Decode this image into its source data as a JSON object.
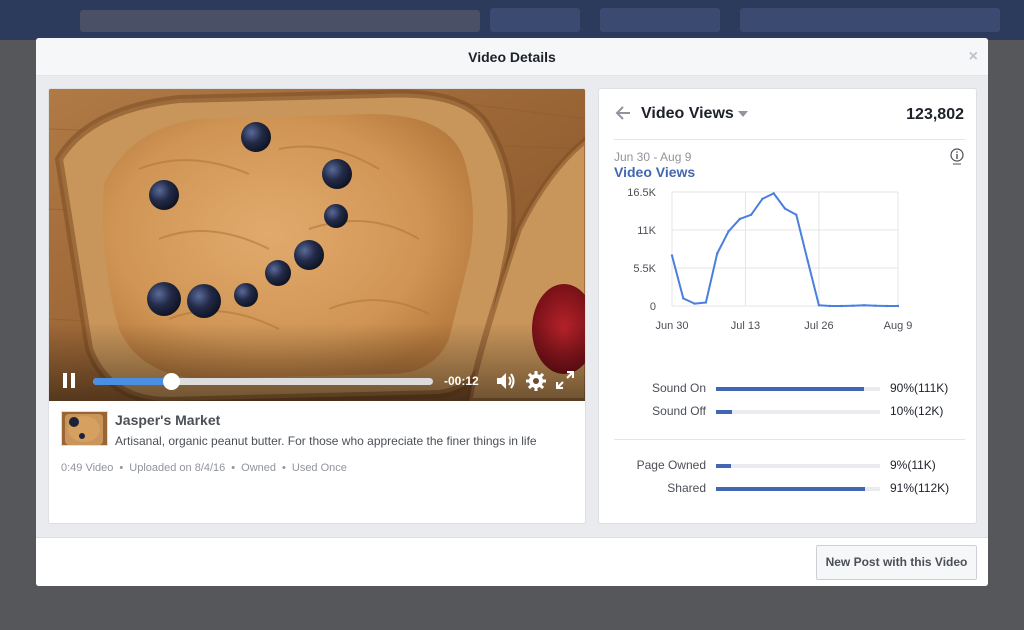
{
  "modal": {
    "title": "Video Details",
    "close_glyph": "×",
    "footer_button": "New Post with this Video"
  },
  "video": {
    "time_remaining": "-00:12",
    "progress": 0.23,
    "page_name": "Jasper's Market",
    "description": "Artisanal, organic peanut butter. For those who appreciate the finer things in life",
    "meta": [
      "0:49 Video",
      "Uploaded on 8/4/16",
      "Owned",
      "Used Once"
    ]
  },
  "insights": {
    "metric_title": "Video Views",
    "total": "123,802",
    "date_range": "Jun 30 - Aug 9",
    "chart_label": "Video Views",
    "stats_audio": [
      {
        "label": "Sound On",
        "value": "90%(111K)",
        "fraction": 0.9
      },
      {
        "label": "Sound Off",
        "value": "10%(12K)",
        "fraction": 0.1
      }
    ],
    "stats_ownership": [
      {
        "label": "Page Owned",
        "value": "9%(11K)",
        "fraction": 0.09
      },
      {
        "label": "Shared",
        "value": "91%(112K)",
        "fraction": 0.91
      }
    ]
  },
  "colors": {
    "accent": "#4267b2",
    "line": "#4a7fe0",
    "scrub": "#4a90e2"
  },
  "chart_data": {
    "type": "line",
    "title": "Video Views",
    "x_tick_labels": [
      "Jun 30",
      "Jul 13",
      "Jul 26",
      "Aug 9"
    ],
    "y_tick_labels": [
      "0",
      "5.5K",
      "11K",
      "16.5K"
    ],
    "ylim": [
      0,
      16500
    ],
    "grid": true,
    "series": [
      {
        "name": "Video Views",
        "x": [
          "Jun 30",
          "Jul 2",
          "Jul 4",
          "Jul 6",
          "Jul 8",
          "Jul 10",
          "Jul 12",
          "Jul 14",
          "Jul 16",
          "Jul 18",
          "Jul 20",
          "Jul 22",
          "Jul 24",
          "Jul 26",
          "Jul 28",
          "Jul 30",
          "Aug 1",
          "Aug 3",
          "Aug 5",
          "Aug 7",
          "Aug 9"
        ],
        "values": [
          7300,
          1100,
          350,
          500,
          7600,
          10800,
          12600,
          13200,
          15500,
          16300,
          14100,
          13200,
          6600,
          100,
          0,
          0,
          50,
          100,
          50,
          0,
          0
        ]
      }
    ]
  }
}
